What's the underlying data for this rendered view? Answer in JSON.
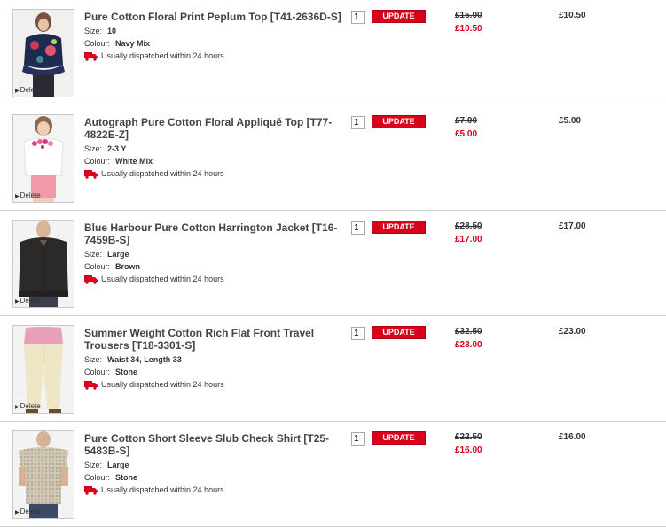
{
  "colors": {
    "accent": "#d9001b",
    "text": "#333333",
    "divider": "#cfcfcf"
  },
  "labels": {
    "size": "Size:",
    "colour": "Colour:",
    "dispatch": "Usually dispatched within 24 hours",
    "update": "UPDATE",
    "delete": "Delete"
  },
  "items": [
    {
      "name": "Pure Cotton Floral Print Peplum Top [T41-2636D-S]",
      "size": "10",
      "colour": "Navy Mix",
      "qty": "1",
      "was": "£15.00",
      "now": "£10.50",
      "total": "£10.50"
    },
    {
      "name": "Autograph Pure Cotton Floral Appliqué Top [T77-4822E-Z]",
      "size": "2-3 Y",
      "colour": "White Mix",
      "qty": "1",
      "was": "£7.00",
      "now": "£5.00",
      "total": "£5.00"
    },
    {
      "name": "Blue Harbour Pure Cotton Harrington Jacket [T16-7459B-S]",
      "size": "Large",
      "colour": "Brown",
      "qty": "1",
      "was": "£28.50",
      "now": "£17.00",
      "total": "£17.00"
    },
    {
      "name": "Summer Weight Cotton Rich Flat Front Travel Trousers [T18-3301-S]",
      "size": "Waist 34, Length 33",
      "colour": "Stone",
      "qty": "1",
      "was": "£32.50",
      "now": "£23.00",
      "total": "£23.00"
    },
    {
      "name": "Pure Cotton Short Sleeve Slub Check Shirt [T25-5483B-S]",
      "size": "Large",
      "colour": "Stone",
      "qty": "1",
      "was": "£22.50",
      "now": "£16.00",
      "total": "£16.00"
    }
  ]
}
